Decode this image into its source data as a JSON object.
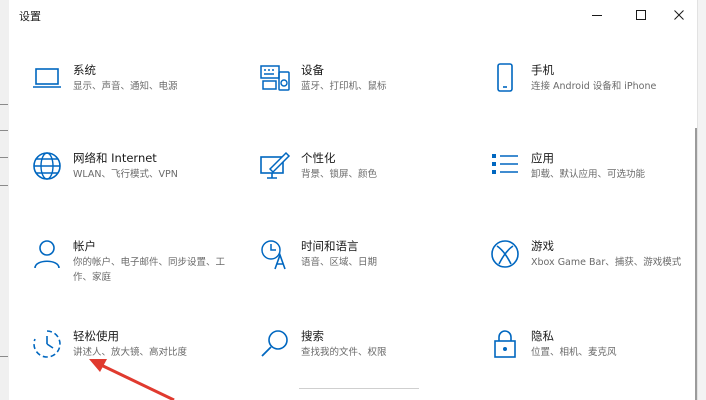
{
  "window": {
    "title": "设置"
  },
  "accent_color": "#0067c0",
  "annotation_color": "#e03a2f",
  "tiles": [
    {
      "name": "系统",
      "desc": "显示、声音、通知、电源",
      "icon": "laptop-icon"
    },
    {
      "name": "设备",
      "desc": "蓝牙、打印机、鼠标",
      "icon": "keyboard-printer-icon"
    },
    {
      "name": "手机",
      "desc": "连接 Android 设备和 iPhone",
      "icon": "phone-icon"
    },
    {
      "name": "网络和 Internet",
      "desc": "WLAN、飞行模式、VPN",
      "icon": "globe-icon"
    },
    {
      "name": "个性化",
      "desc": "背景、锁屏、颜色",
      "icon": "paint-monitor-icon"
    },
    {
      "name": "应用",
      "desc": "卸载、默认应用、可选功能",
      "icon": "list-apps-icon"
    },
    {
      "name": "帐户",
      "desc": "你的帐户、电子邮件、同步设置、工作、家庭",
      "icon": "person-icon"
    },
    {
      "name": "时间和语言",
      "desc": "语音、区域、日期",
      "icon": "time-language-icon"
    },
    {
      "name": "游戏",
      "desc": "Xbox Game Bar、捕获、游戏模式",
      "icon": "xbox-icon"
    },
    {
      "name": "轻松使用",
      "desc": "讲述人、放大镜、高对比度",
      "icon": "ease-of-access-icon"
    },
    {
      "name": "搜索",
      "desc": "查找我的文件、权限",
      "icon": "search-icon"
    },
    {
      "name": "隐私",
      "desc": "位置、相机、麦克风",
      "icon": "lock-icon"
    }
  ]
}
